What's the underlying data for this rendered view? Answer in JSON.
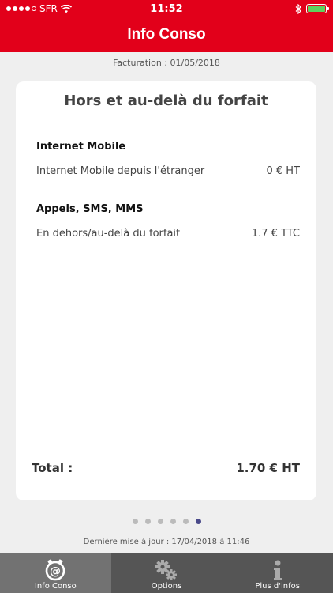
{
  "status_bar": {
    "carrier": "SFR",
    "time": "11:52",
    "battery_color": "#5dd35d"
  },
  "header": {
    "title": "Info Conso",
    "background": "#e2001a"
  },
  "billing": "Facturation : 01/05/2018",
  "card": {
    "title": "Hors et au-delà du forfait",
    "sections": [
      {
        "title": "Internet Mobile",
        "rows": [
          {
            "label": "Internet Mobile depuis l'étranger",
            "value": "0 € HT"
          }
        ]
      },
      {
        "title": "Appels, SMS, MMS",
        "rows": [
          {
            "label": "En dehors/au-delà du forfait",
            "value": "1.7 € TTC"
          }
        ]
      }
    ],
    "total_label": "Total :",
    "total_value": "1.70 € HT"
  },
  "pager": {
    "count": 6,
    "active_index": 5
  },
  "last_update": "Dernière mise à jour : 17/04/2018 à 11:46",
  "tabs": [
    {
      "label": "Info Conso",
      "icon": "at-clock-icon",
      "active": true
    },
    {
      "label": "Options",
      "icon": "gears-icon",
      "active": false
    },
    {
      "label": "Plus d'infos",
      "icon": "info-icon",
      "active": false
    }
  ]
}
